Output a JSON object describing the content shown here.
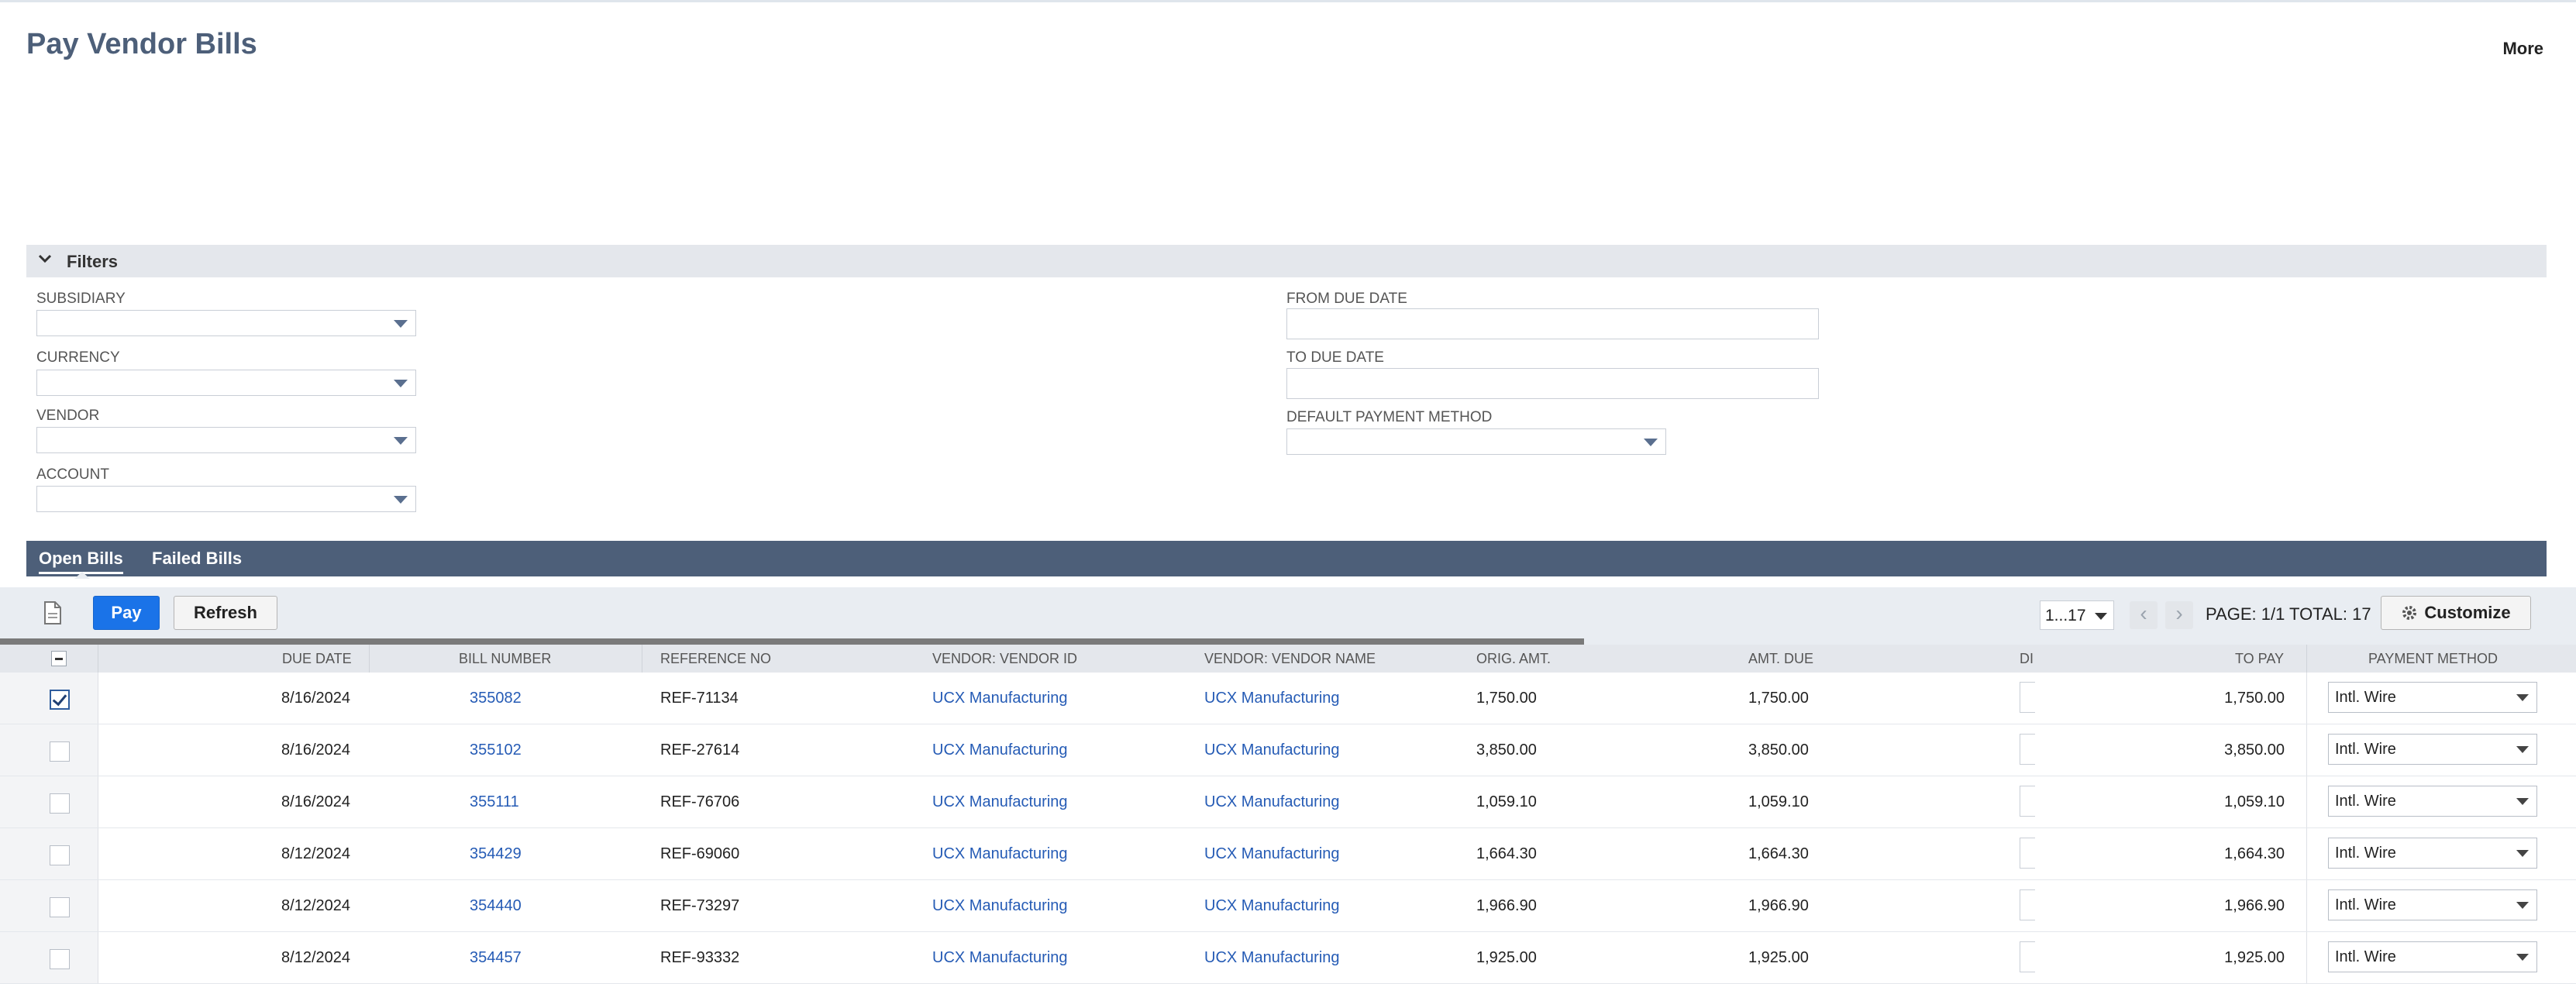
{
  "page": {
    "title": "Pay Vendor Bills",
    "more_label": "More"
  },
  "filters": {
    "section_label": "Filters",
    "subsidiary_label": "SUBSIDIARY",
    "currency_label": "CURRENCY",
    "vendor_label": "VENDOR",
    "account_label": "ACCOUNT",
    "from_due_date_label": "FROM DUE DATE",
    "to_due_date_label": "TO DUE DATE",
    "default_payment_method_label": "DEFAULT PAYMENT METHOD",
    "subsidiary_value": "",
    "currency_value": "",
    "vendor_value": "",
    "account_value": "",
    "from_due_date_value": "",
    "to_due_date_value": "",
    "default_payment_method_value": ""
  },
  "tabs": [
    {
      "label": "Open Bills",
      "active": true
    },
    {
      "label": "Failed Bills",
      "active": false
    }
  ],
  "toolbar": {
    "pay_label": "Pay",
    "refresh_label": "Refresh",
    "range_value": "1...17",
    "page_info": "PAGE: 1/1  TOTAL: 17",
    "customize_label": "Customize"
  },
  "table": {
    "columns": {
      "due_date": "DUE DATE",
      "bill_number": "BILL NUMBER",
      "reference_no": "REFERENCE NO",
      "vendor_id": "VENDOR: VENDOR ID",
      "vendor_name": "VENDOR: VENDOR NAME",
      "orig_amt": "ORIG. AMT.",
      "amt_due": "AMT. DUE",
      "disc": "DI",
      "to_pay": "TO PAY",
      "payment_method": "PAYMENT METHOD"
    },
    "rows": [
      {
        "checked": true,
        "due_date": "8/16/2024",
        "bill_number": "355082",
        "reference_no": "REF-71134",
        "vendor_id": "UCX Manufacturing",
        "vendor_name": "UCX Manufacturing",
        "orig_amt": "1,750.00",
        "amt_due": "1,750.00",
        "to_pay": "1,750.00",
        "payment_method": "Intl. Wire"
      },
      {
        "checked": false,
        "due_date": "8/16/2024",
        "bill_number": "355102",
        "reference_no": "REF-27614",
        "vendor_id": "UCX Manufacturing",
        "vendor_name": "UCX Manufacturing",
        "orig_amt": "3,850.00",
        "amt_due": "3,850.00",
        "to_pay": "3,850.00",
        "payment_method": "Intl. Wire"
      },
      {
        "checked": false,
        "due_date": "8/16/2024",
        "bill_number": "355111",
        "reference_no": "REF-76706",
        "vendor_id": "UCX Manufacturing",
        "vendor_name": "UCX Manufacturing",
        "orig_amt": "1,059.10",
        "amt_due": "1,059.10",
        "to_pay": "1,059.10",
        "payment_method": "Intl. Wire"
      },
      {
        "checked": false,
        "due_date": "8/12/2024",
        "bill_number": "354429",
        "reference_no": "REF-69060",
        "vendor_id": "UCX Manufacturing",
        "vendor_name": "UCX Manufacturing",
        "orig_amt": "1,664.30",
        "amt_due": "1,664.30",
        "to_pay": "1,664.30",
        "payment_method": "Intl. Wire"
      },
      {
        "checked": false,
        "due_date": "8/12/2024",
        "bill_number": "354440",
        "reference_no": "REF-73297",
        "vendor_id": "UCX Manufacturing",
        "vendor_name": "UCX Manufacturing",
        "orig_amt": "1,966.90",
        "amt_due": "1,966.90",
        "to_pay": "1,966.90",
        "payment_method": "Intl. Wire"
      },
      {
        "checked": false,
        "due_date": "8/12/2024",
        "bill_number": "354457",
        "reference_no": "REF-93332",
        "vendor_id": "UCX Manufacturing",
        "vendor_name": "UCX Manufacturing",
        "orig_amt": "1,925.00",
        "amt_due": "1,925.00",
        "to_pay": "1,925.00",
        "payment_method": "Intl. Wire"
      }
    ]
  }
}
